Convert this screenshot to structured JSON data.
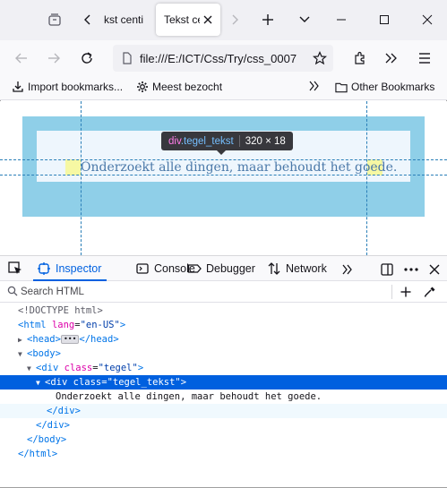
{
  "browser": {
    "tabs": [
      {
        "label": "kst centi",
        "active": false
      },
      {
        "label": "Tekst ce",
        "active": true
      }
    ],
    "url": "file:///E:/ICT/Css/Try/css_0007",
    "bookmarks": [
      {
        "label": "Import bookmarks...",
        "icon": "import-icon"
      },
      {
        "label": "Meest bezocht",
        "icon": "gear-icon"
      }
    ],
    "other_bookmarks": "Other Bookmarks"
  },
  "page": {
    "text": "Onderzoekt alle dingen, maar behoudt het goede.",
    "colors": {
      "tile": "#8fcfe8",
      "inner": "#eef6fd",
      "padding": "#f6f8a3",
      "text": "#4a78a8"
    }
  },
  "highlighter": {
    "tag": "div",
    "class_name": ".tegel_tekst",
    "size": "320 × 18"
  },
  "devtools": {
    "tabs": [
      {
        "label": "Inspector",
        "icon": "inspector-icon",
        "active": true
      },
      {
        "label": "Console",
        "icon": "console-icon",
        "active": false
      },
      {
        "label": "Debugger",
        "icon": "debugger-icon",
        "active": false
      },
      {
        "label": "Network",
        "icon": "network-icon",
        "active": false
      }
    ],
    "search_placeholder": "Search HTML"
  },
  "markup": {
    "doctype": "<!DOCTYPE html>",
    "html_open": "<html",
    "html_lang_attr": "lang",
    "html_lang_val": "\"en-US\"",
    "head_open": "<head>",
    "head_close": "</head>",
    "body_open": "<body>",
    "div_tag": "<div",
    "class_attr": "class",
    "tegel_class": "\"tegel\"",
    "tegel_tekst_class": "\"tegel_tekst\"",
    "tag_end": ">",
    "text_node": "Onderzoekt alle dingen, maar behoudt het goede.",
    "div_close": "</div>",
    "body_close": "</body>",
    "html_close": "</html>"
  }
}
